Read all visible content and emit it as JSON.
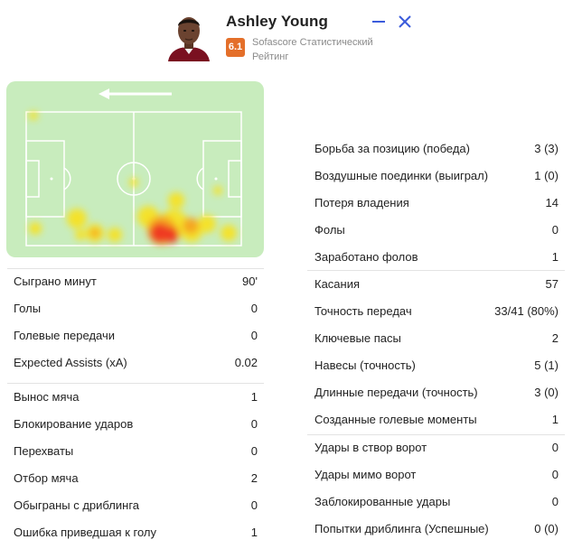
{
  "player": {
    "name": "Ashley Young",
    "rating": "6.1",
    "rating_label": "Sofascore Статистический Рейтинг"
  },
  "colors": {
    "rating_badge": "#e46f2a",
    "pitch": "#c8ecbd",
    "window_buttons": "#3b5bdb"
  },
  "icons": {
    "minimize": "minimize-icon",
    "close": "close-icon",
    "direction": "attack-direction-arrow-icon"
  },
  "left_stats": {
    "group1": [
      {
        "label": "Сыграно минут",
        "value": "90'"
      },
      {
        "label": "Голы",
        "value": "0"
      },
      {
        "label": "Голевые передачи",
        "value": "0"
      },
      {
        "label": "Expected Assists (xA)",
        "value": "0.02"
      }
    ],
    "group2": [
      {
        "label": "Вынос мяча",
        "value": "1"
      },
      {
        "label": "Блокирование ударов",
        "value": "0"
      },
      {
        "label": "Перехваты",
        "value": "0"
      },
      {
        "label": "Отбор мяча",
        "value": "2"
      },
      {
        "label": "Обыграны с дриблинга",
        "value": "0"
      },
      {
        "label": "Ошибка приведшая к голу",
        "value": "1"
      }
    ]
  },
  "right_stats": {
    "group1": [
      {
        "label": "Борьба за позицию (победа)",
        "value": "3 (3)"
      },
      {
        "label": "Воздушные поединки (выиграл)",
        "value": "1 (0)"
      },
      {
        "label": "Потеря владения",
        "value": "14"
      },
      {
        "label": "Фолы",
        "value": "0"
      },
      {
        "label": "Заработано фолов",
        "value": "1"
      }
    ],
    "group2": [
      {
        "label": "Касания",
        "value": "57"
      },
      {
        "label": "Точность передач",
        "value": "33/41 (80%)"
      },
      {
        "label": "Ключевые пасы",
        "value": "2"
      },
      {
        "label": "Навесы (точность)",
        "value": "5 (1)"
      },
      {
        "label": "Длинные передачи (точность)",
        "value": "3 (0)"
      },
      {
        "label": "Созданные голевые моменты",
        "value": "1"
      }
    ],
    "group3": [
      {
        "label": "Удары в створ ворот",
        "value": "0"
      },
      {
        "label": "Удары мимо ворот",
        "value": "0"
      },
      {
        "label": "Заблокированные удары",
        "value": "0"
      },
      {
        "label": "Попытки дриблинга (Успешные)",
        "value": "0 (0)"
      }
    ]
  }
}
